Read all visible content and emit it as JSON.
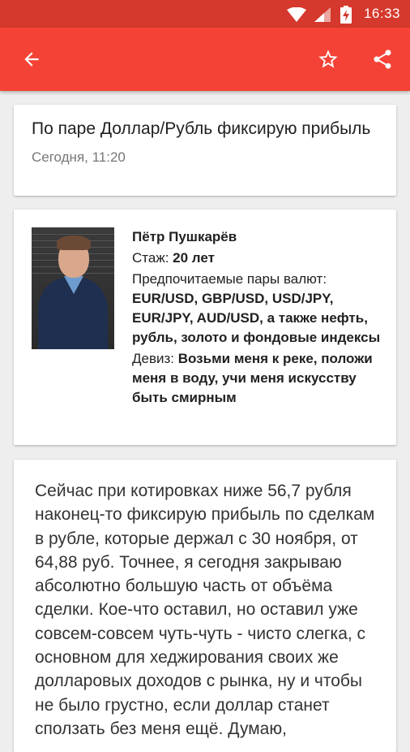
{
  "status_bar": {
    "time": "16:33"
  },
  "toolbar": {
    "back_icon": "arrow-back-icon",
    "favorite_icon": "star-outline-icon",
    "share_icon": "share-icon",
    "color": "#f44336"
  },
  "post": {
    "title": "По паре Доллар/Рубль фиксирую прибыль",
    "date": "Сегодня, 11:20"
  },
  "author": {
    "name": "Пётр Пушкарёв",
    "experience_label": "Стаж:",
    "experience_value": "20 лет",
    "pairs_label": "Предпочитаемые пары валют:",
    "pairs_value": "EUR/USD, GBP/USD, USD/JPY, EUR/JPY, AUD/USD, а также нефть, рубль, золото и фондовые индексы",
    "motto_label": "Девиз:",
    "motto_value": "Возьми меня к реке, положи меня в воду, учи меня искусству быть смирным"
  },
  "body": {
    "text": "Сейчас при котировках ниже 56,7 рубля наконец-то фиксирую прибыль по сделкам в рубле, которые держал с 30 ноября, от 64,88 руб. Точнее, я сегодня закрываю абсолютно большую часть от объёма сделки. Кое-что оставил, но оставил уже совсем-совсем чуть-чуть - чисто слегка, с основном для хеджирования своих же долларовых доходов с рынка, ну и чтобы не было грустно, если доллар станет сползать без меня ещё. Думаю,"
  }
}
